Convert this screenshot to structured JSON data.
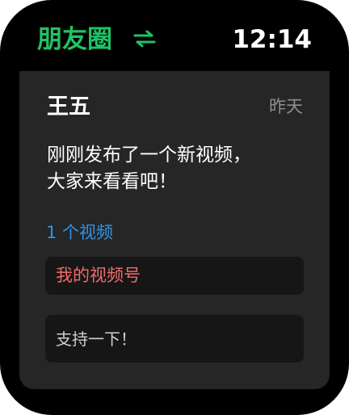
{
  "header": {
    "app_title": "朋友圈",
    "switch_icon": "switch-arrows-icon",
    "time": "12:14"
  },
  "post": {
    "author": "王五",
    "time": "昨天",
    "text_lines": [
      "刚刚发布了一个新视频，",
      "大家来看看吧！"
    ],
    "video_count": "1 个视频",
    "channel_label": "我的视频号"
  },
  "comment": {
    "placeholder": "支持一下！"
  },
  "colors": {
    "accent_green": "#1fc365",
    "link_blue": "#2f93ea",
    "channel_red": "#f16b6b",
    "card_bg": "#262626",
    "box_bg": "#161616"
  }
}
